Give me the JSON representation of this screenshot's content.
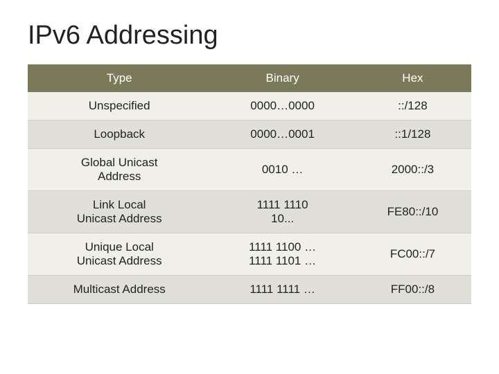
{
  "page": {
    "title": "IPv6 Addressing"
  },
  "table": {
    "headers": [
      "Type",
      "Binary",
      "Hex"
    ],
    "rows": [
      {
        "type": "Unspecified",
        "binary": "0000…0000",
        "hex": ": :/128",
        "rowspan": 1
      },
      {
        "type": "Loopback",
        "binary": "0000…0001",
        "hex": ": :1/128",
        "rowspan": 1
      },
      {
        "type": "Global Unicast Address",
        "binary": "0010 …",
        "hex": "2000: :/3",
        "rowspan": 1
      },
      {
        "type": "Link Local Unicast Address",
        "binary": "1111 1110\n10...",
        "hex": "FE80: :/10",
        "rowspan": 1
      },
      {
        "type": "Unique Local Unicast Address",
        "binary": "1111 1100 …\n1111 1101 …",
        "hex": "FC00: :/7",
        "rowspan": 1
      },
      {
        "type": "Multicast Address",
        "binary": "1111 1111 …",
        "hex": "FF00: :/8",
        "rowspan": 1
      }
    ]
  }
}
